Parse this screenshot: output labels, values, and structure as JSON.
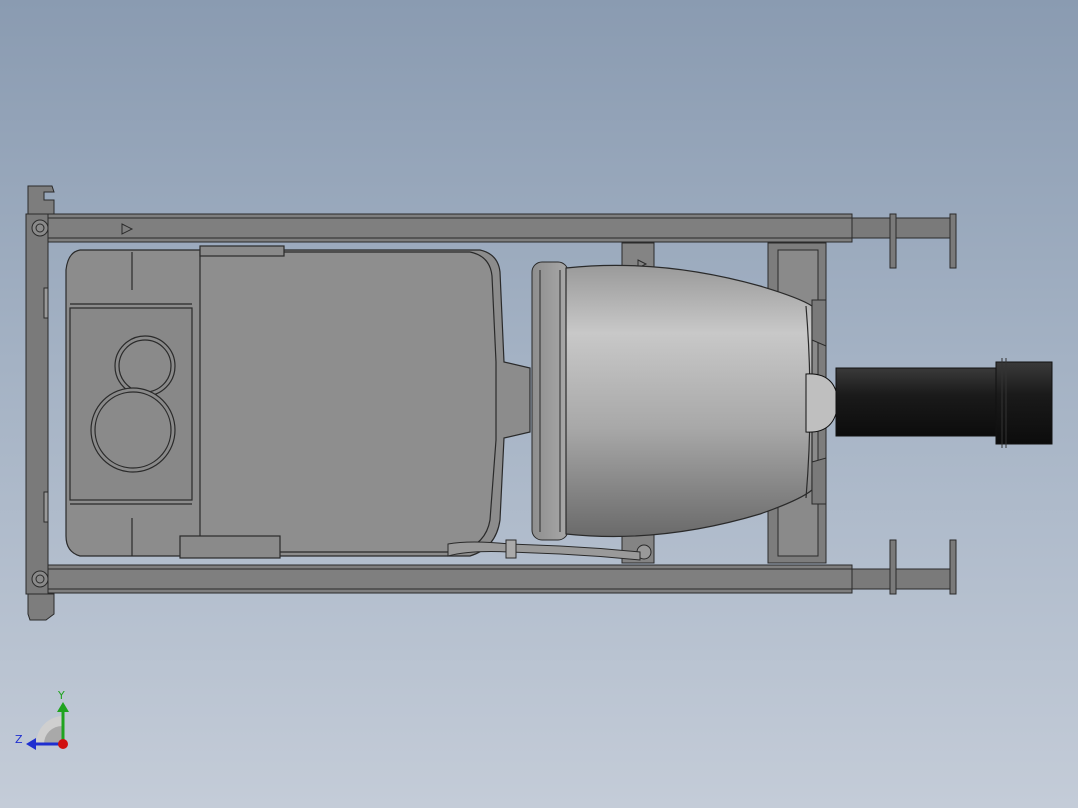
{
  "viewport": {
    "background_top": "#8a9bb1",
    "background_bottom": "#c4ccd8"
  },
  "triad": {
    "y_label": "Y",
    "z_label": "Z",
    "y_color": "#1fa31f",
    "z_color": "#1f2fd0",
    "x_color": "#d01010"
  },
  "model": {
    "frame_color": "#7b7b7b",
    "body_color": "#8c8c8c",
    "housing_color": "#b9b9b9",
    "pipe_color": "#1c1c1c",
    "edge_color": "#2a2a2a"
  }
}
